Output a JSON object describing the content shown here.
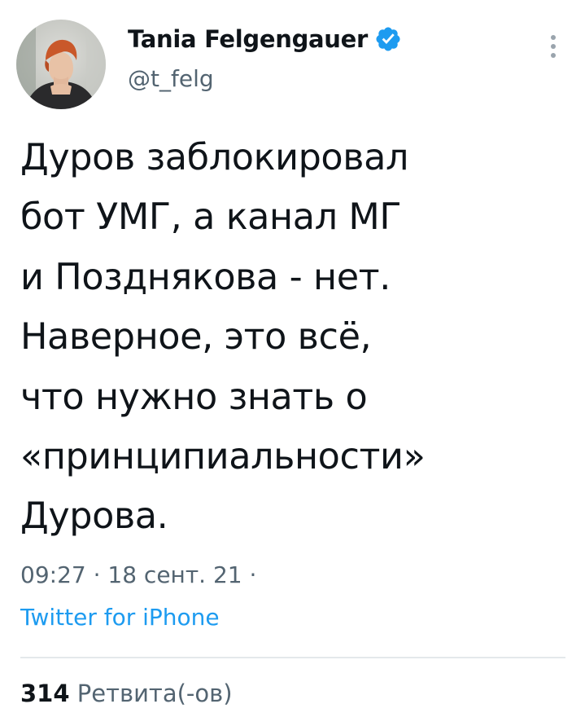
{
  "author": {
    "display_name": "Tania Felgengauer",
    "handle": "@t_felg",
    "verified": true,
    "avatar_icon": "profile-photo"
  },
  "menu": {
    "icon": "more-vertical-icon"
  },
  "tweet": {
    "text": "Дуров заблокировал\nбот УМГ, а канал МГ\nи Позднякова - нет.\nНаверное, это всё,\nчто нужно знать о\n«принципиальности»\nДурова.",
    "meta": "09:27 · 18 сент. 21 ·",
    "source": "Twitter for iPhone"
  },
  "stats": {
    "retweet_count": "314",
    "retweet_label": "Ретвита(-ов)"
  },
  "colors": {
    "text": "#0f1419",
    "secondary": "#536471",
    "accent": "#1d9bf0",
    "divider": "#e4e8eb"
  }
}
